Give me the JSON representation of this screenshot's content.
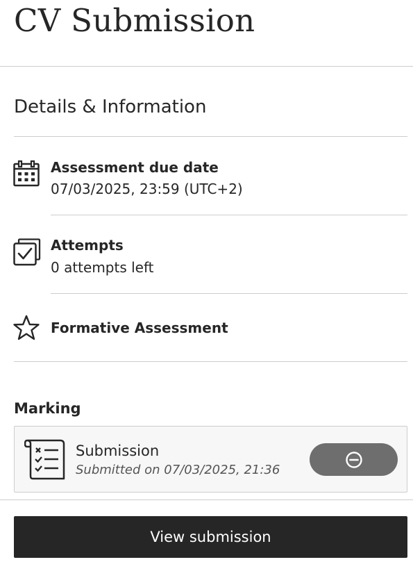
{
  "page": {
    "title": "CV Submission"
  },
  "details": {
    "heading": "Details & Information",
    "due_date": {
      "label": "Assessment due date",
      "value": "07/03/2025, 23:59 (UTC+2)",
      "icon": "calendar-icon"
    },
    "attempts": {
      "label": "Attempts",
      "value": "0 attempts left",
      "icon": "attempts-checkbox-icon"
    },
    "formative": {
      "label": "Formative Assessment",
      "icon": "star-icon"
    }
  },
  "marking": {
    "heading": "Marking",
    "submission": {
      "title": "Submission",
      "subtitle": "Submitted on 07/03/2025, 21:36",
      "icon": "checklist-document-icon",
      "status_icon": "minus-circle-icon"
    }
  },
  "footer": {
    "view_label": "View submission"
  },
  "colors": {
    "text": "#262626",
    "divider": "#cdcdcd",
    "pill": "#6e6e6e",
    "button": "#262626",
    "card_bg": "#f7f7f7"
  }
}
